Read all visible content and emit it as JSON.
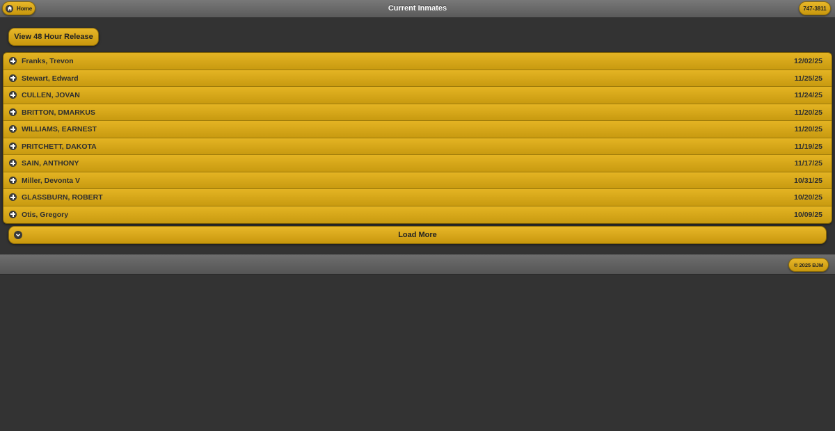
{
  "header": {
    "title": "Current Inmates",
    "home_label": "Home",
    "home_icon": "home-icon",
    "phone_label": "747-3811"
  },
  "actions": {
    "release_label": "View 48 Hour Release"
  },
  "inmates": [
    {
      "name": "Franks, Trevon",
      "date": "12/02/25"
    },
    {
      "name": "Stewart, Edward",
      "date": "11/25/25"
    },
    {
      "name": "CULLEN, JOVAN",
      "date": "11/24/25"
    },
    {
      "name": "BRITTON, DMARKUS",
      "date": "11/20/25"
    },
    {
      "name": "WILLIAMS, EARNEST",
      "date": "11/20/25"
    },
    {
      "name": "PRITCHETT, DAKOTA",
      "date": "11/19/25"
    },
    {
      "name": "SAIN, ANTHONY",
      "date": "11/17/25"
    },
    {
      "name": "Miller, Devonta V",
      "date": "10/31/25"
    },
    {
      "name": "GLASSBURN, ROBERT",
      "date": "10/20/25"
    },
    {
      "name": "Otis, Gregory",
      "date": "10/09/25"
    }
  ],
  "load_more": {
    "label": "Load More",
    "icon": "chevron-down-icon"
  },
  "footer": {
    "copyright": "© 2025 BJM"
  },
  "colors": {
    "background": "#333333",
    "accent": "#d9a71b",
    "bar": "#666666"
  }
}
